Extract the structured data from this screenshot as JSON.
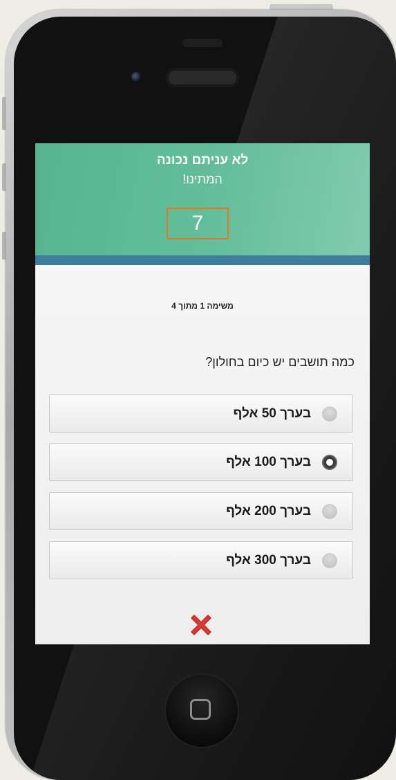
{
  "header": {
    "result_title": "לא עניתם נכונה",
    "result_subtitle": "המתינו!",
    "countdown": "7"
  },
  "task_label": "משימה 1 מתוך 4",
  "question": "כמה תושבים יש כיום בחולון?",
  "options": [
    {
      "label": "בערך 50 אלף",
      "selected": false
    },
    {
      "label": "בערך 100 אלף",
      "selected": true
    },
    {
      "label": "בערך 200 אלף",
      "selected": false
    },
    {
      "label": "בערך 300 אלף",
      "selected": false
    }
  ],
  "result_icon": "red-x-icon",
  "colors": {
    "banner": "#5db894",
    "banner_stripe": "#3f7d9d",
    "countdown_border": "#e8761e",
    "wrong_mark": "#d83a32"
  }
}
